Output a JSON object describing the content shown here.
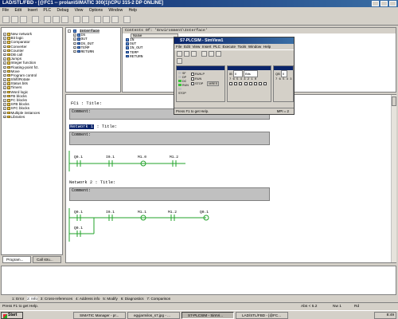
{
  "window": {
    "title": "LAD/STL/FBD  - [@FC1 -- prolan\\SIMATIC 300(1)\\CPU 315-2 DP  ONLINE]"
  },
  "menu": [
    "File",
    "Edit",
    "Insert",
    "PLC",
    "Debug",
    "View",
    "Options",
    "Window",
    "Help"
  ],
  "tree": {
    "items": [
      "New network",
      "Bit logic",
      "Comparator",
      "Converter",
      "Counter",
      "DB call",
      "Jumps",
      "Integer function",
      "Floating-point fct.",
      "Move",
      "Program control",
      "Shift/Rotate",
      "Status bits",
      "Timers",
      "Word logic",
      "FB blocks",
      "FC blocks",
      "SFB blocks",
      "SFC blocks",
      "Multiple instances",
      "Libraries"
    ],
    "tabs": [
      "Program...",
      "Call stru..."
    ]
  },
  "interface": {
    "root": "Interface",
    "items": [
      "IN",
      "OUT",
      "IN_OUT",
      "TEMP",
      "RETURN"
    ],
    "contents_title": "Contents Of: 'Environment\\Interface'",
    "column": "Name",
    "rows": [
      "IN",
      "OUT",
      "IN_OUT",
      "TEMP",
      "RETURN"
    ]
  },
  "editor": {
    "fc_title": "FC1 : Title:",
    "comment": "Comment:",
    "network1": {
      "label": "Network 1",
      "title": ": Title:",
      "contacts": [
        "Q0.1",
        "I0.1",
        "M1.0",
        "M1.2"
      ]
    },
    "network2": {
      "label": "Network 2",
      "title": ": Title:",
      "contacts": [
        "Q0.1",
        "I0.1",
        "M1.1",
        "M1.2",
        "Q0.1"
      ],
      "branch": "Q0.1"
    }
  },
  "plcsim": {
    "title": "S7-PLCSIM - SimView1",
    "menu": [
      "File",
      "Edit",
      "View",
      "Insert",
      "PLC",
      "Execute",
      "Tools",
      "Window",
      "Help"
    ],
    "cpu": {
      "modes": [
        "RUN-P",
        "RUN",
        "STOP"
      ],
      "leds": [
        "SF",
        "DP",
        "DC",
        "RUN",
        "STOP"
      ],
      "mres": "MRES"
    },
    "panels": [
      {
        "addr_prefix": "IB",
        "addr": "0",
        "format": "Bits",
        "bits": "7 6 5 4 3 2 1 0"
      },
      {
        "addr_prefix": "QB",
        "addr": "0",
        "format": "Bits",
        "bits": "7 6 5 4 3 2 1 0"
      }
    ],
    "status": "Press F1 to get Help.",
    "mpi": "MPI = 2"
  },
  "bottom_tabs": [
    "1: Error",
    "2: Info",
    "3: Cross-references",
    "4: Address info",
    "5: Modify",
    "6: Diagnostics",
    "7: Comparison"
  ],
  "statusbar": {
    "help": "Press F1 to get Help.",
    "abs": "Abs < 5.2",
    "nw": "Nw 1",
    "mode": "Rd"
  },
  "taskbar": {
    "start": "Start",
    "tasks": [
      "SIMATIC Manager - pr...",
      "egyjarmilos_s7.jpg - ...",
      "S7-PLCSIM - SimVi...",
      "LAD/STL/FBD - [@FC..."
    ],
    "active_index": 2,
    "clock": "8:49"
  }
}
